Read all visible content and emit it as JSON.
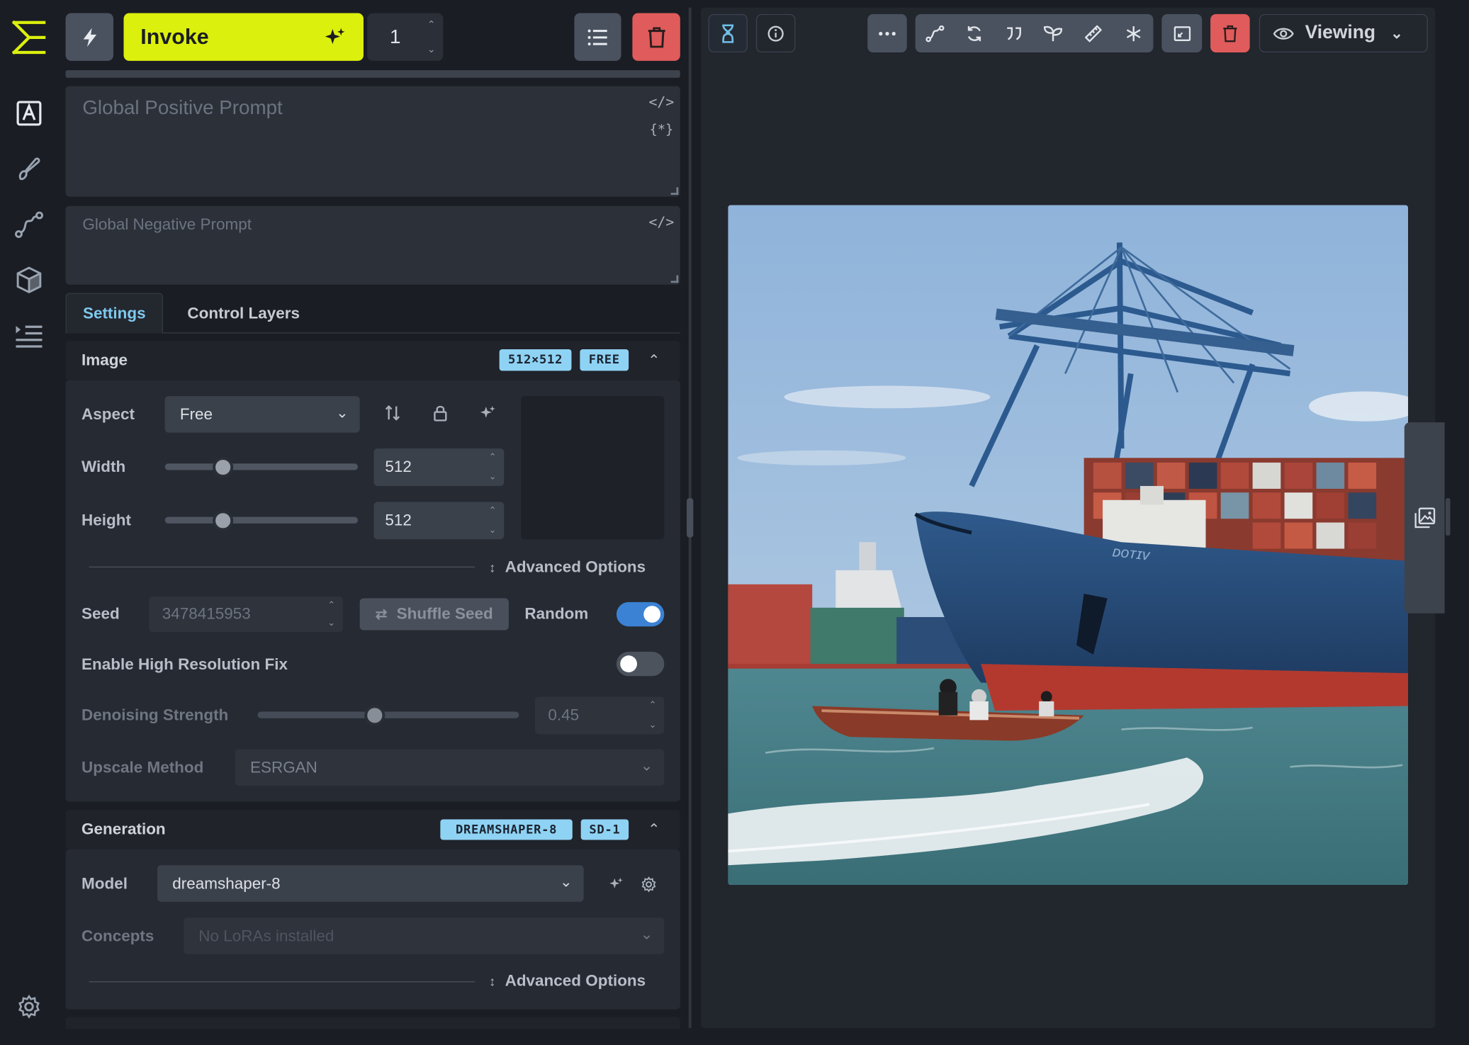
{
  "topbar": {
    "invoke_label": "Invoke",
    "iterations": "1"
  },
  "prompts": {
    "positive_placeholder": "Global Positive Prompt",
    "negative_placeholder": "Global Negative Prompt"
  },
  "tabs": [
    {
      "label": "Settings",
      "active": true
    },
    {
      "label": "Control Layers",
      "active": false
    }
  ],
  "image_section": {
    "title": "Image",
    "badges": [
      "512×512",
      "FREE"
    ],
    "aspect_label": "Aspect",
    "aspect_value": "Free",
    "width_label": "Width",
    "width_value": "512",
    "height_label": "Height",
    "height_value": "512",
    "advanced_label": "Advanced Options",
    "seed_label": "Seed",
    "seed_value": "3478415953",
    "shuffle_label": "Shuffle Seed",
    "random_label": "Random",
    "random_on": true,
    "hires_label": "Enable High Resolution Fix",
    "hires_on": false,
    "denoise_label": "Denoising Strength",
    "denoise_value": "0.45",
    "upscale_label": "Upscale Method",
    "upscale_value": "ESRGAN"
  },
  "generation_section": {
    "title": "Generation",
    "badges": [
      "DREAMSHAPER-8",
      "SD-1"
    ],
    "model_label": "Model",
    "model_value": "dreamshaper-8",
    "concepts_label": "Concepts",
    "concepts_placeholder": "No LoRAs installed",
    "advanced_label": "Advanced Options"
  },
  "viewer": {
    "viewing_label": "Viewing"
  },
  "colors": {
    "accent": "#dcf00d",
    "badge": "#8fd3f4",
    "toggle_on": "#3b82d4",
    "danger": "#e05b5b"
  }
}
